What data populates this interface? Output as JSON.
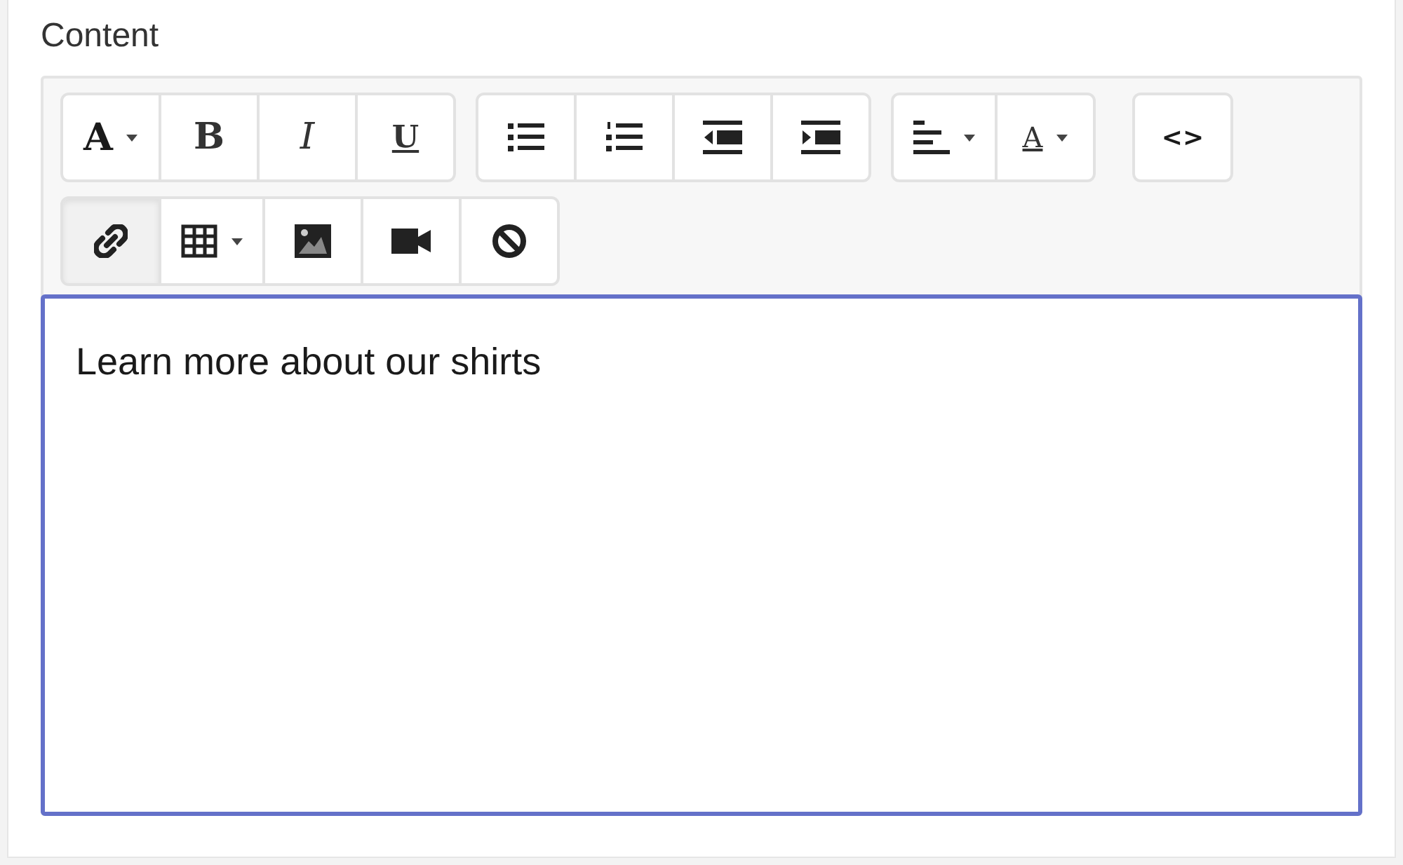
{
  "field": {
    "label": "Content"
  },
  "toolbar": {
    "rows": [
      [
        [
          {
            "kind": "text",
            "label": "A",
            "dropdown": true,
            "active": false
          },
          {
            "kind": "bold",
            "label": "B",
            "dropdown": false,
            "active": false
          },
          {
            "kind": "italic",
            "label": "I",
            "dropdown": false,
            "active": false
          },
          {
            "kind": "underline",
            "label": "U",
            "dropdown": false,
            "active": false
          }
        ],
        [
          {
            "kind": "unordered-list",
            "dropdown": false,
            "active": false
          },
          {
            "kind": "ordered-list",
            "dropdown": false,
            "active": false
          },
          {
            "kind": "outdent",
            "dropdown": false,
            "active": false
          },
          {
            "kind": "indent",
            "dropdown": false,
            "active": false
          }
        ],
        [
          {
            "kind": "align",
            "dropdown": true,
            "active": false
          },
          {
            "kind": "color",
            "label": "A",
            "dropdown": true,
            "active": false
          }
        ],
        [
          {
            "kind": "text",
            "label": "<>",
            "dropdown": false,
            "active": false
          }
        ]
      ],
      [
        [
          {
            "kind": "link",
            "dropdown": false,
            "active": true
          },
          {
            "kind": "table",
            "dropdown": true,
            "active": false
          },
          {
            "kind": "picture",
            "dropdown": false,
            "active": false
          },
          {
            "kind": "video",
            "dropdown": false,
            "active": false
          },
          {
            "kind": "clear",
            "dropdown": false,
            "active": false
          }
        ]
      ]
    ]
  },
  "editor": {
    "value": "Learn more about our shirts",
    "focused": true
  }
}
